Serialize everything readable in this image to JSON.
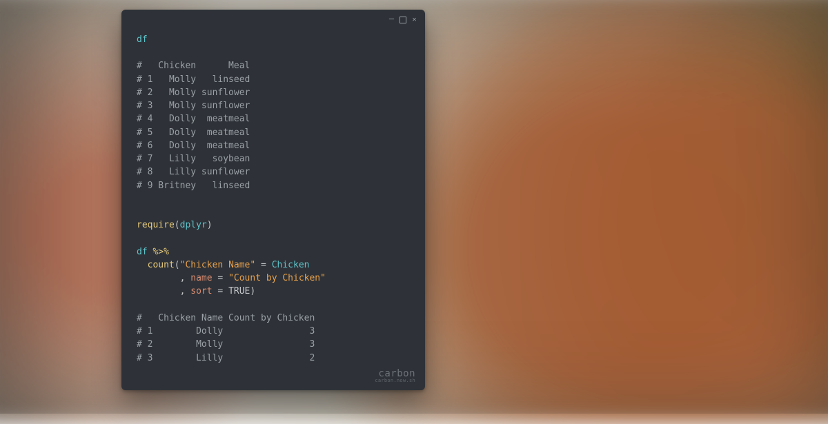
{
  "window": {
    "controls": {
      "min": "minimize",
      "max": "maximize",
      "close": "close"
    }
  },
  "code": {
    "l01_df": "df",
    "table_header": "#   Chicken      Meal",
    "table_rows": [
      "# 1   Molly   linseed",
      "# 2   Molly sunflower",
      "# 3   Molly sunflower",
      "# 4   Dolly  meatmeal",
      "# 5   Dolly  meatmeal",
      "# 6   Dolly  meatmeal",
      "# 7   Lilly   soybean",
      "# 8   Lilly sunflower",
      "# 9 Britney   linseed"
    ],
    "require_fn": "require",
    "require_arg": "dplyr",
    "df2": "df",
    "pipe": "%>%",
    "count_fn": "count",
    "count_str1": "\"Chicken Name\"",
    "count_eq1_rhs": "Chicken",
    "count_name_arg": "name",
    "count_name_val": "\"Count by Chicken\"",
    "count_sort_arg": "sort",
    "count_sort_val": "TRUE",
    "result_header": "#   Chicken Name Count by Chicken",
    "result_rows": [
      "# 1        Dolly                3",
      "# 2        Molly                3",
      "# 3        Lilly                2"
    ]
  },
  "watermark": {
    "brand": "carbon",
    "sub": "carbon.now.sh"
  },
  "chart_data": {
    "type": "table",
    "tables": [
      {
        "name": "df",
        "columns": [
          "Chicken",
          "Meal"
        ],
        "rows": [
          [
            "Molly",
            "linseed"
          ],
          [
            "Molly",
            "sunflower"
          ],
          [
            "Molly",
            "sunflower"
          ],
          [
            "Dolly",
            "meatmeal"
          ],
          [
            "Dolly",
            "meatmeal"
          ],
          [
            "Dolly",
            "meatmeal"
          ],
          [
            "Lilly",
            "soybean"
          ],
          [
            "Lilly",
            "sunflower"
          ],
          [
            "Britney",
            "linseed"
          ]
        ]
      },
      {
        "name": "count_by_chicken",
        "columns": [
          "Chicken Name",
          "Count by Chicken"
        ],
        "rows": [
          [
            "Dolly",
            3
          ],
          [
            "Molly",
            3
          ],
          [
            "Lilly",
            2
          ]
        ]
      }
    ]
  }
}
